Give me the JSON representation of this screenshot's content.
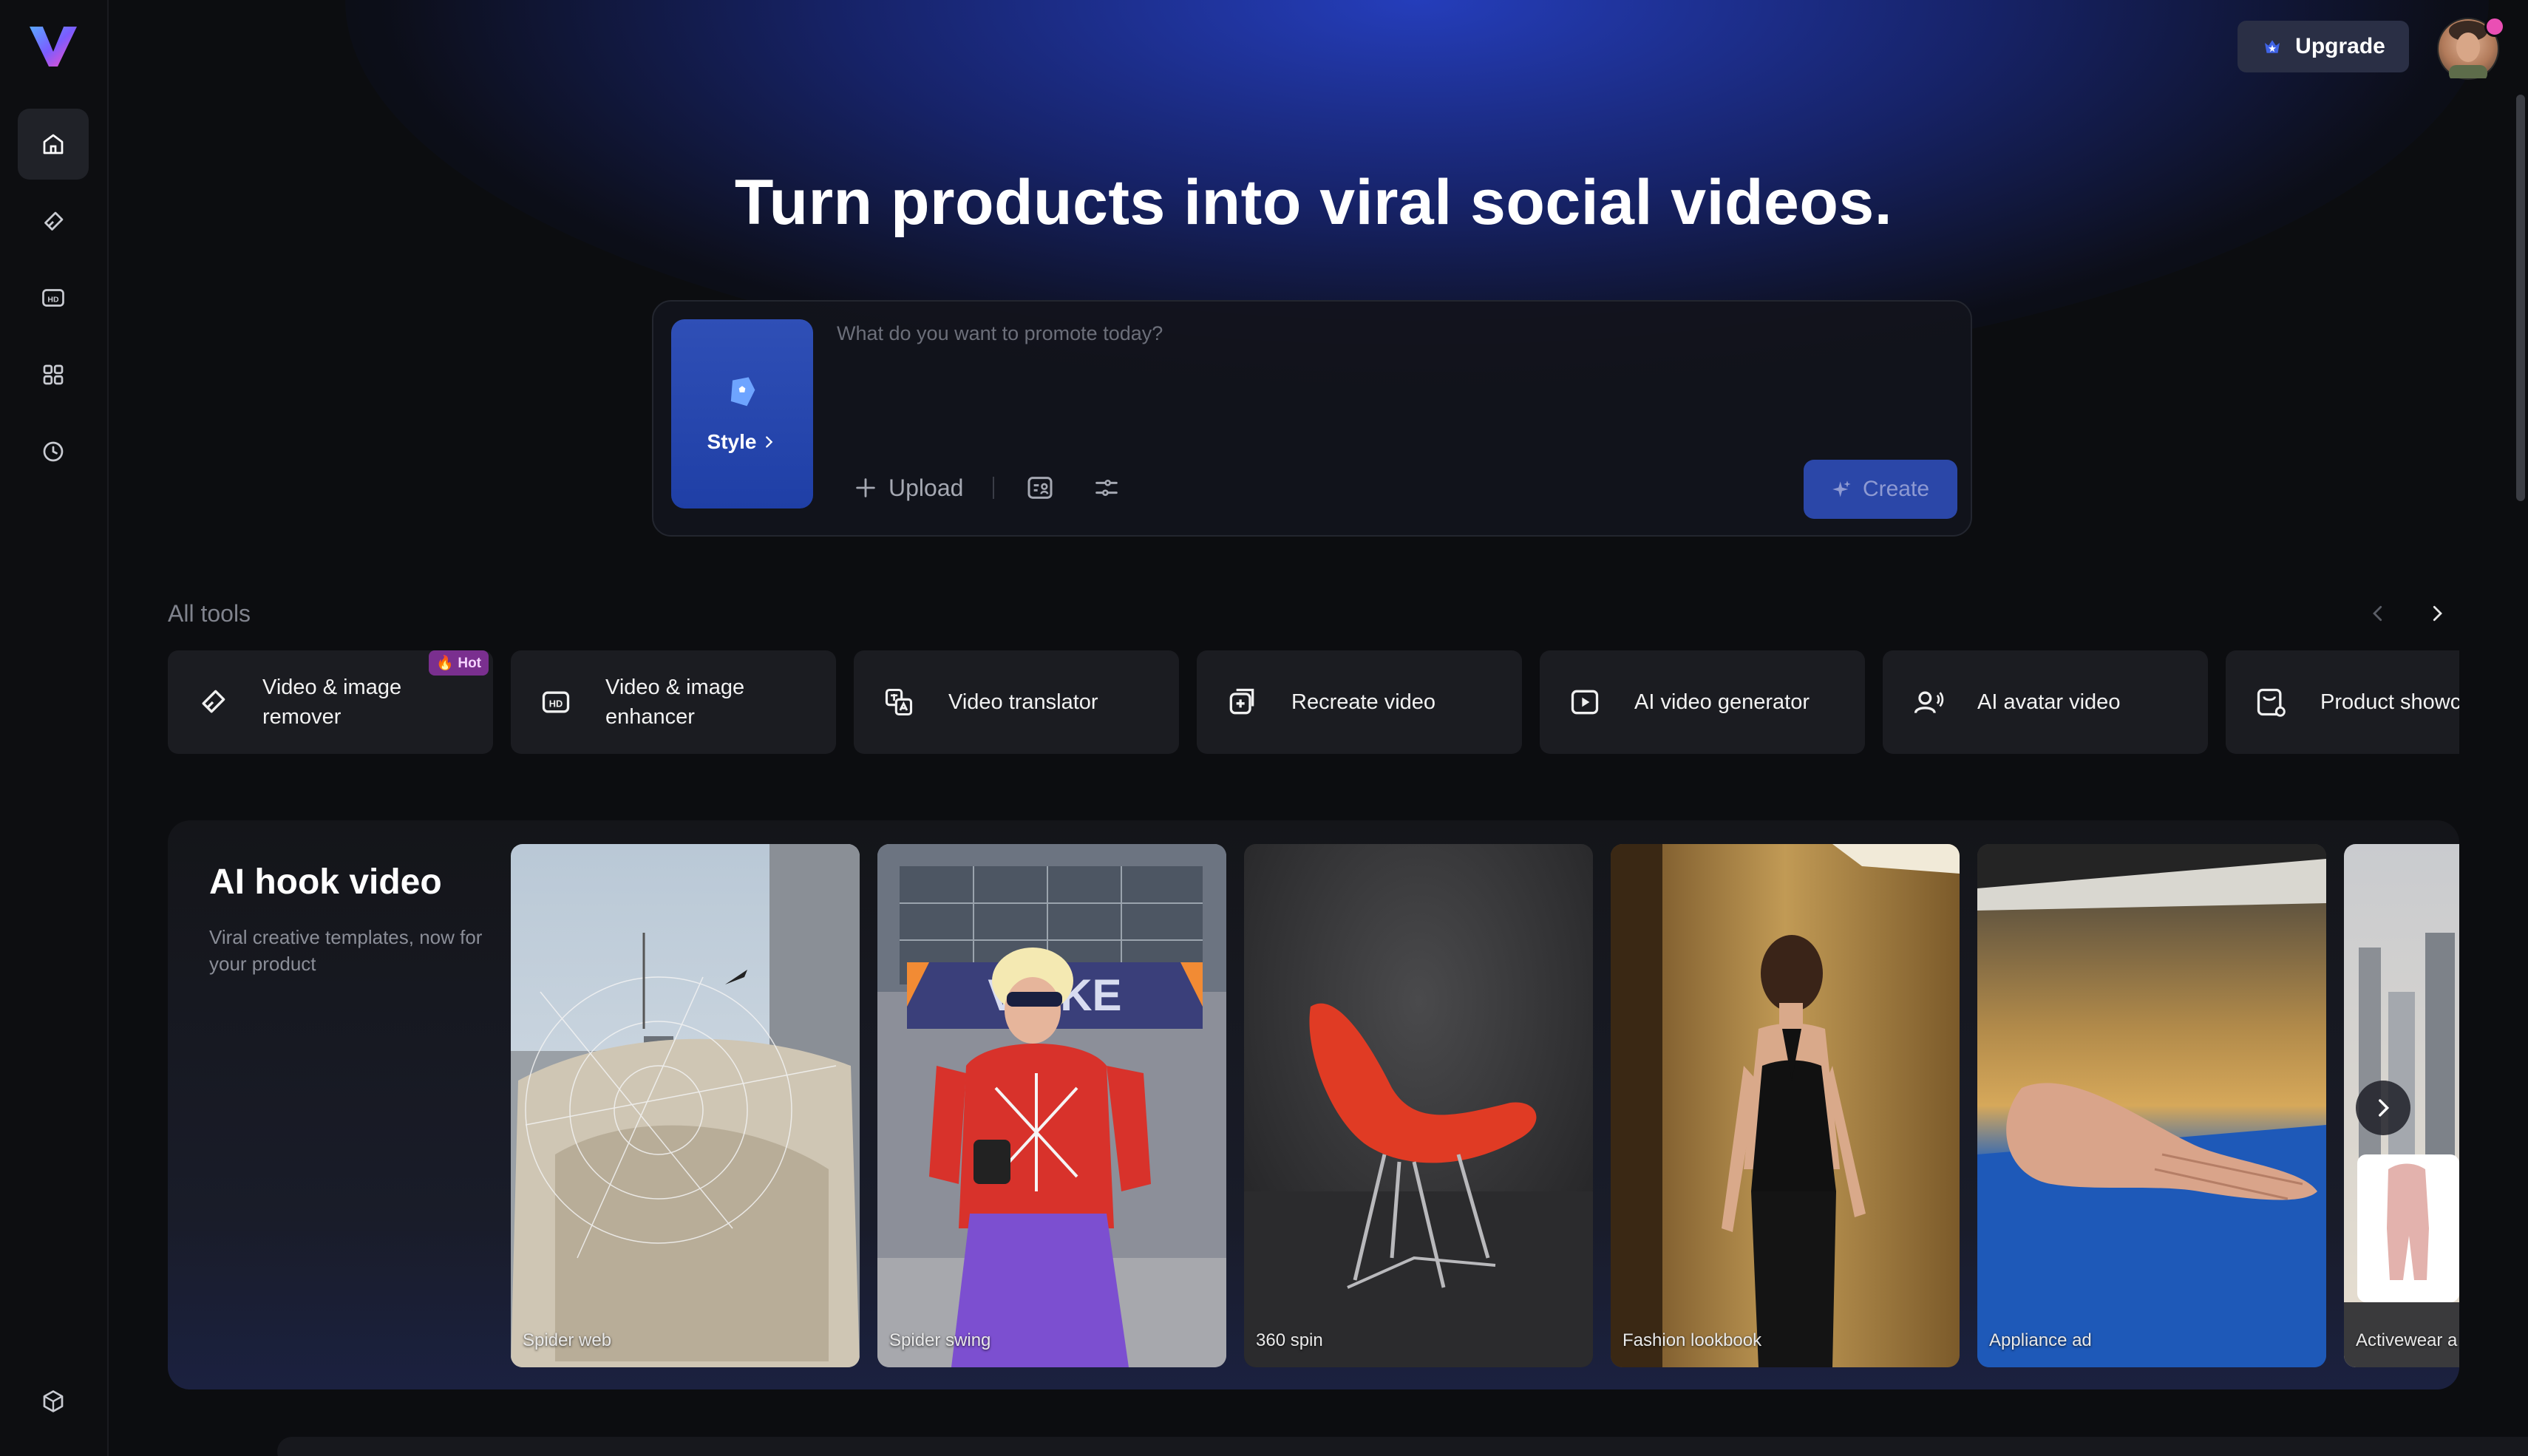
{
  "app": {
    "logo_icon": "brand-v-logo-icon",
    "accent": "#2b47a8"
  },
  "sidebar": {
    "items": [
      {
        "name": "home",
        "icon": "home-icon",
        "active": true
      },
      {
        "name": "eraser",
        "icon": "eraser-icon",
        "active": false
      },
      {
        "name": "hd",
        "icon": "hd-icon",
        "active": false
      },
      {
        "name": "apps",
        "icon": "grid-icon",
        "active": false
      },
      {
        "name": "history",
        "icon": "clock-icon",
        "active": false
      }
    ],
    "bottom_icon": "box-icon"
  },
  "header": {
    "upgrade_label": "Upgrade",
    "upgrade_icon": "crown-star-icon"
  },
  "hero": {
    "headline": "Turn products into viral social videos."
  },
  "prompt": {
    "placeholder": "What do you want to promote today?",
    "style_label": "Style",
    "upload_label": "Upload",
    "create_label": "Create"
  },
  "tools": {
    "title": "All tools",
    "items": [
      {
        "label": "Video & image remover",
        "icon": "eraser-icon",
        "badge": "🔥 Hot"
      },
      {
        "label": "Video & image enhancer",
        "icon": "hd-icon"
      },
      {
        "label": "Video translator",
        "icon": "translate-icon"
      },
      {
        "label": "Recreate video",
        "icon": "recreate-icon"
      },
      {
        "label": "AI video generator",
        "icon": "play-square-icon"
      },
      {
        "label": "AI avatar video",
        "icon": "avatar-voice-icon"
      },
      {
        "label": "Product showc",
        "icon": "product-icon"
      }
    ]
  },
  "hook": {
    "title": "AI hook video",
    "subtitle": "Viral creative templates, now for your product",
    "templates": [
      {
        "label": "Spider web"
      },
      {
        "label": "Spider swing",
        "sign_text": "V  AKE"
      },
      {
        "label": "360 spin"
      },
      {
        "label": "Fashion lookbook"
      },
      {
        "label": "Appliance ad"
      },
      {
        "label": "Activewear a"
      }
    ]
  }
}
